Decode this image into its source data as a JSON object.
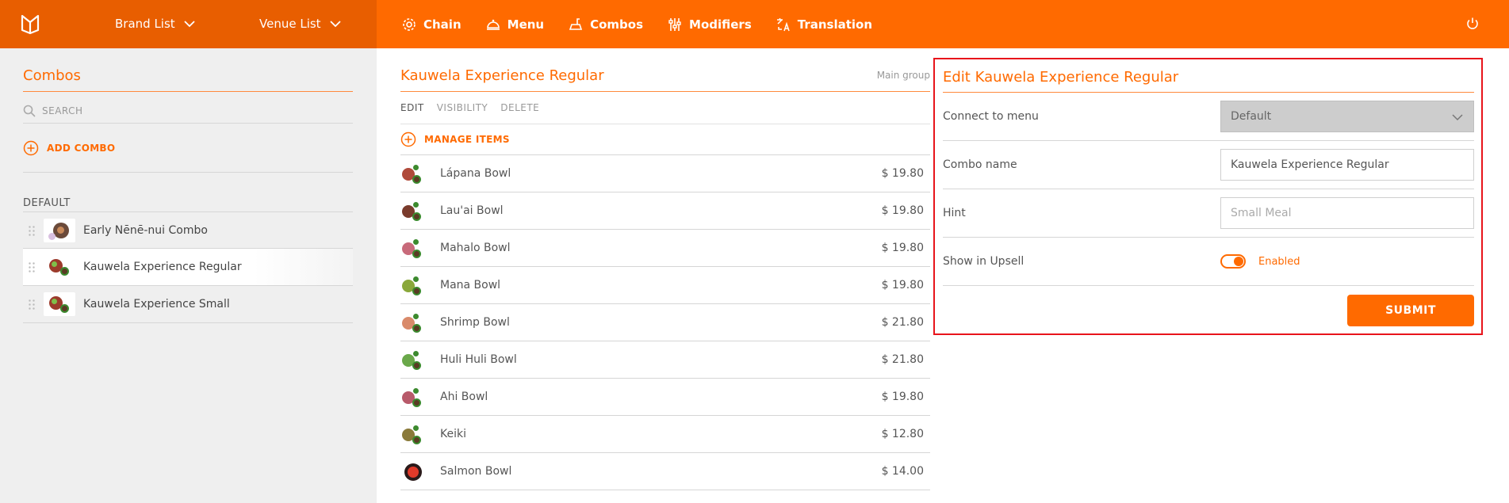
{
  "header": {
    "brand_list": "Brand List",
    "venue_list": "Venue List",
    "nav": [
      {
        "label": "Chain",
        "icon": "gear-icon"
      },
      {
        "label": "Menu",
        "icon": "cloche-icon"
      },
      {
        "label": "Combos",
        "icon": "combo-icon"
      },
      {
        "label": "Modifiers",
        "icon": "sliders-icon"
      },
      {
        "label": "Translation",
        "icon": "translate-icon"
      }
    ]
  },
  "sidebar": {
    "title": "Combos",
    "search_placeholder": "SEARCH",
    "add_label": "ADD COMBO",
    "group": "DEFAULT",
    "items": [
      {
        "label": "Early Nēnē-nui Combo"
      },
      {
        "label": "Kauwela Experience Regular"
      },
      {
        "label": "Kauwela Experience Small"
      }
    ],
    "active_index": 1
  },
  "main": {
    "title": "Kauwela Experience Regular",
    "subtitle": "Main group",
    "tabs": [
      "EDIT",
      "VISIBILITY",
      "DELETE"
    ],
    "manage_label": "MANAGE ITEMS",
    "items": [
      {
        "name": "Lápana Bowl",
        "price": "$ 19.80"
      },
      {
        "name": "Lau'ai Bowl",
        "price": "$ 19.80"
      },
      {
        "name": "Mahalo Bowl",
        "price": "$ 19.80"
      },
      {
        "name": "Mana Bowl",
        "price": "$ 19.80"
      },
      {
        "name": "Shrimp Bowl",
        "price": "$ 21.80"
      },
      {
        "name": "Huli Huli Bowl",
        "price": "$ 21.80"
      },
      {
        "name": "Ahi Bowl",
        "price": "$ 19.80"
      },
      {
        "name": "Keiki",
        "price": "$ 12.80"
      },
      {
        "name": "Salmon Bowl",
        "price": "$ 14.00"
      }
    ]
  },
  "edit": {
    "title": "Edit Kauwela Experience Regular",
    "connect_label": "Connect to menu",
    "connect_value": "Default",
    "name_label": "Combo name",
    "name_value": "Kauwela Experience Regular",
    "hint_label": "Hint",
    "hint_placeholder": "Small Meal",
    "upsell_label": "Show in Upsell",
    "upsell_state": "Enabled",
    "submit_label": "SUBMIT"
  },
  "colors": {
    "accent": "#ff6a00",
    "header_dark": "#e85e00",
    "highlight_border": "#e8141b"
  }
}
